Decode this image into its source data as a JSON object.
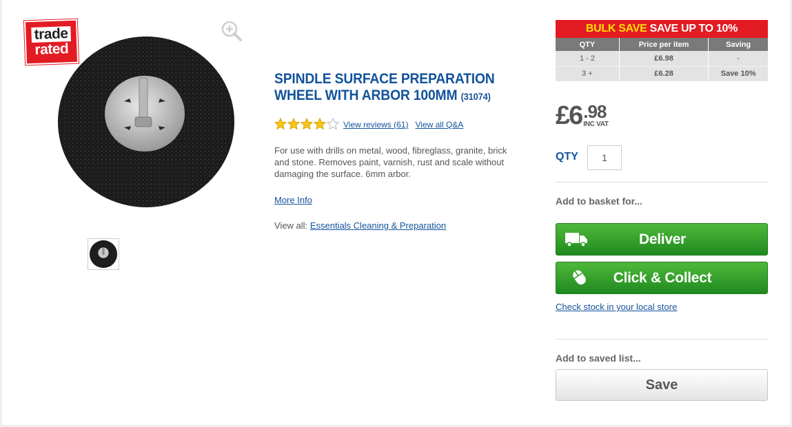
{
  "badge": {
    "line1": "trade",
    "line2": "rated"
  },
  "product": {
    "title": "SPINDLE SURFACE PREPARATION WHEEL WITH ARBOR 100MM",
    "code": "(31074)",
    "rating": 4.0,
    "rating_max": 5,
    "reviews_link": "View reviews (61)",
    "qa_link": "View all Q&A",
    "description": "For use with drills on metal, wood, fibreglass, granite, brick and stone. Removes paint, varnish, rust and scale without damaging the surface. 6mm arbor.",
    "more_info": "More Info",
    "view_all_prefix": "View all:",
    "view_all_link": "Essentials Cleaning & Preparation"
  },
  "bulk": {
    "highlight": "BULK SAVE",
    "text": "SAVE UP TO 10%",
    "headers": [
      "QTY",
      "Price per item",
      "Saving"
    ],
    "rows": [
      [
        "1 - 2",
        "£6.98",
        "-"
      ],
      [
        "3 +",
        "£6.28",
        "Save 10%"
      ]
    ]
  },
  "price": {
    "pounds": "£6",
    "pence": ".98",
    "vat": "INC VAT"
  },
  "qty": {
    "label": "QTY",
    "value": "1"
  },
  "basket": {
    "label": "Add to basket for...",
    "deliver": "Deliver",
    "collect": "Click & Collect",
    "check_stock": "Check stock in your local store"
  },
  "saved": {
    "label": "Add to saved list...",
    "save": "Save"
  },
  "colors": {
    "brand_blue": "#13539c",
    "red": "#e31b23",
    "green": "#2e9b2a",
    "yellow": "#ffe000"
  }
}
